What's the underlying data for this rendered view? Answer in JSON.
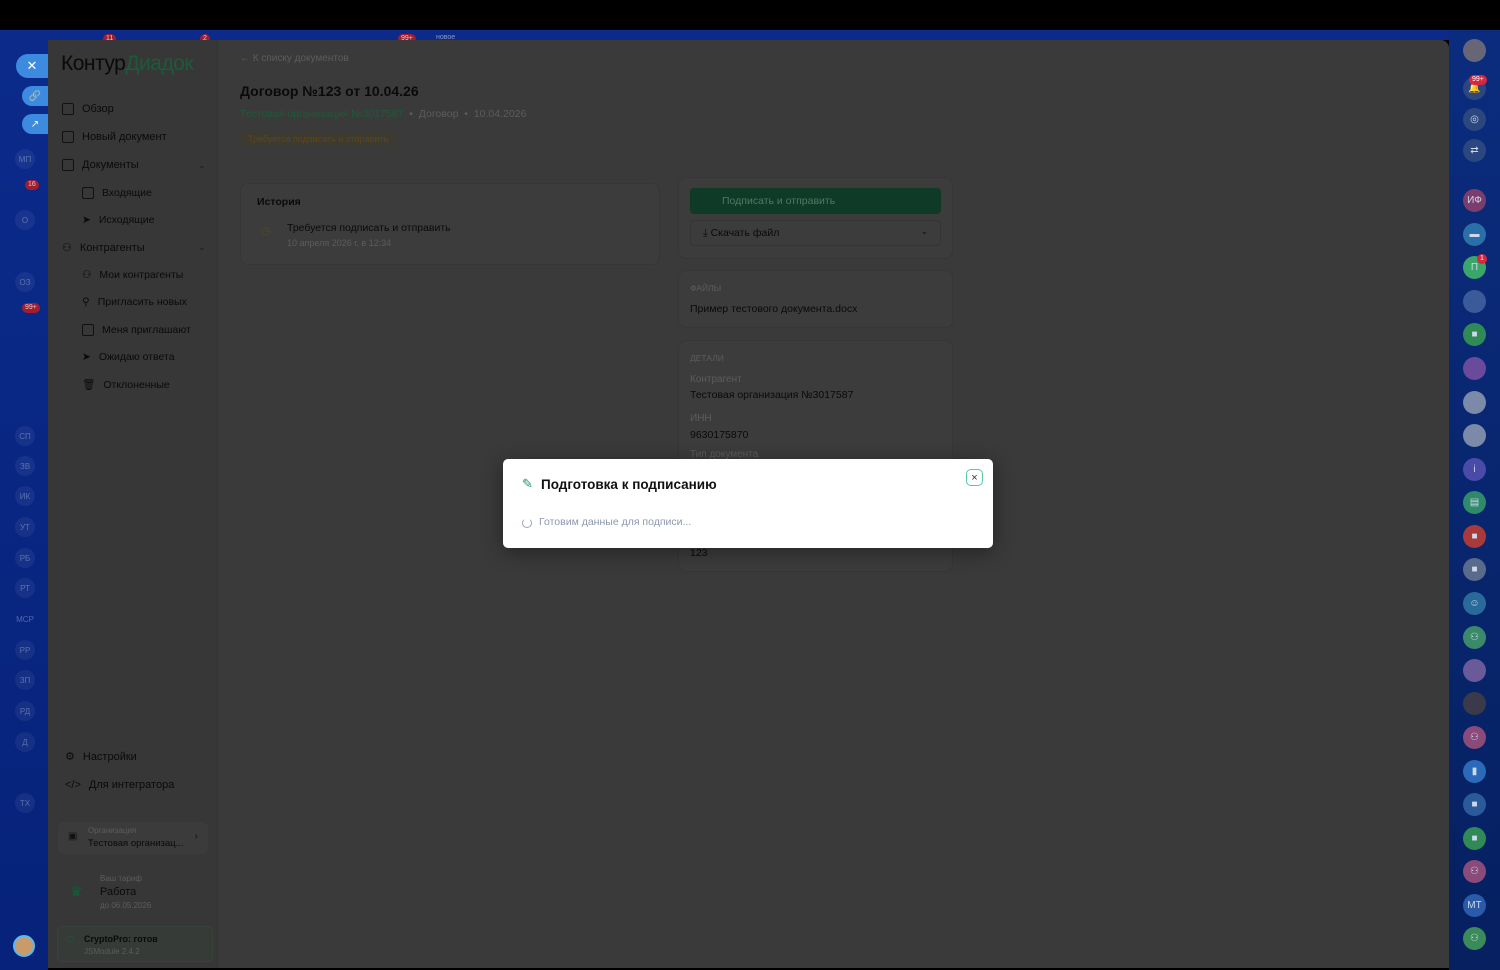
{
  "left_rail": {
    "badges": [
      "11",
      "2",
      "99+",
      "новое"
    ],
    "items": [
      "МП",
      "16",
      "О",
      "ОЗ",
      "99+",
      "СП",
      "ЗВ",
      "ИК",
      "УТ",
      "РБ",
      "РТ",
      "MCP",
      "РР",
      "ЗП",
      "РД",
      "Д",
      "ТХ"
    ]
  },
  "right_rail": {
    "notifications_badge": "99+",
    "items": [
      "ИФ",
      "П",
      "1",
      "МТ"
    ]
  },
  "sidebar": {
    "logo_main": "Контур",
    "logo_accent": "Диадок",
    "items": [
      {
        "label": "Обзор"
      },
      {
        "label": "Новый документ"
      },
      {
        "label": "Документы"
      },
      {
        "label": "Входящие"
      },
      {
        "label": "Исходящие"
      },
      {
        "label": "Контрагенты"
      },
      {
        "label": "Мои контрагенты"
      },
      {
        "label": "Пригласить новых"
      },
      {
        "label": "Меня приглашают"
      },
      {
        "label": "Ожидаю ответа"
      },
      {
        "label": "Отклоненные"
      }
    ],
    "settings": "Настройки",
    "integrator": "Для интегратора",
    "org_label": "Организация",
    "org_name": "Тестовая организац...",
    "tariff_label": "Ваш тариф",
    "tariff_name": "Работа",
    "tariff_until": "до 06.05.2026",
    "crypto_status": "CryptoPro: готов",
    "crypto_version": "JSModule 2.4.2"
  },
  "main": {
    "back_link": "К списку документов",
    "title": "Договор №123 от 10.04.26",
    "org_link": "Тестовая организация №3017587",
    "doc_type": "Договор",
    "date": "10.04.2026",
    "status": "Требуется подписать и отправить",
    "history_title": "История",
    "history_event": "Требуется подписать и отправить",
    "history_time": "10 апреля 2026 г. в 12:34",
    "sign_button": "Подписать и отправить",
    "download_button": "Скачать файл",
    "files_title": "ФАЙЛЫ",
    "file_name": "Пример тестового документа.docx",
    "details_title": "ДЕТАЛИ",
    "counterparty_label": "Контрагент",
    "counterparty": "Тестовая организация №3017587",
    "inn_label": "ИНН",
    "inn": "9630175870",
    "doctype_label": "Тип документа",
    "number": "123"
  },
  "modal": {
    "title": "Подготовка к подписанию",
    "message": "Готовим данные для подписи...",
    "close": "×"
  }
}
